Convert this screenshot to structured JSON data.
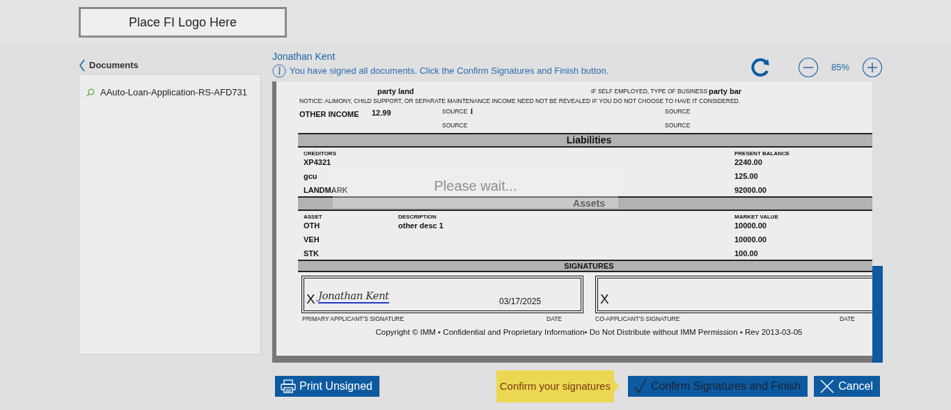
{
  "header": {
    "logo_text": "Place FI Logo Here"
  },
  "sidebar": {
    "title": "Documents",
    "items": [
      {
        "label": "AAuto-Loan-Application-RS-AFD731"
      }
    ]
  },
  "viewer": {
    "signer": "Jonathan Kent",
    "notice": "You have signed all documents. Click the Confirm Signatures and Finish button.",
    "zoom": "85%"
  },
  "document": {
    "income": {
      "employer_value": "party land",
      "business_label": "IF SELF EMPLOYED, TYPE OF BUSINESS",
      "business_value": "party bar",
      "notice": "NOTICE: ALIMONY, CHILD SUPPORT, OR SEPARATE MAINTENANCE INCOME NEED NOT BE REVEALED IF YOU DO NOT CHOOSE TO HAVE IT CONSIDERED.",
      "other_income_label": "OTHER INCOME",
      "other_income_value": "12.99",
      "source_value": "I",
      "source_labels": [
        "SOURCE",
        "SOURCE",
        "SOURCE",
        "SOURCE"
      ]
    },
    "liabilities": {
      "title": "Liabilities",
      "columns": [
        "CREDITORS",
        "PRESENT BALANCE"
      ],
      "rows": [
        {
          "creditor": "XP4321",
          "balance": "2240.00"
        },
        {
          "creditor": "gcu",
          "balance": "125.00"
        },
        {
          "creditor": "LANDMARK",
          "balance": "92000.00"
        }
      ]
    },
    "assets": {
      "title": "Assets",
      "columns": [
        "ASSET",
        "DESCRIPTION",
        "MARKET VALUE"
      ],
      "rows": [
        {
          "asset": "OTH",
          "description": "other desc 1",
          "value": "10000.00"
        },
        {
          "asset": "VEH",
          "value": "10000.00"
        },
        {
          "asset": "STK",
          "value": "100.00"
        }
      ]
    },
    "signatures": {
      "title": "SIGNATURES",
      "boxes": [
        {
          "mark": "X",
          "signature": "Jonathan Kent",
          "date": "03/17/2025",
          "label": "PRIMARY APPLICANT'S SIGNATURE",
          "date_label": "DATE"
        },
        {
          "mark": "X",
          "label": "CO-APPLICANT'S SIGNATURE",
          "date_label": "DATE"
        }
      ]
    },
    "footer": "Copyright © IMM • Confidential and Proprietary Information• Do Not Distribute without IMM Permission • Rev 2013-03-05"
  },
  "loading": "Please wait...",
  "tooltip": "Confirm your signatures",
  "buttons": [
    {
      "label": "Print Unsigned",
      "kind": "print",
      "disabled": false
    },
    {
      "label": "Confirm Signatures and Finish",
      "kind": "confirm",
      "disabled": true
    },
    {
      "label": "Cancel",
      "kind": "cancel",
      "disabled": false
    }
  ]
}
